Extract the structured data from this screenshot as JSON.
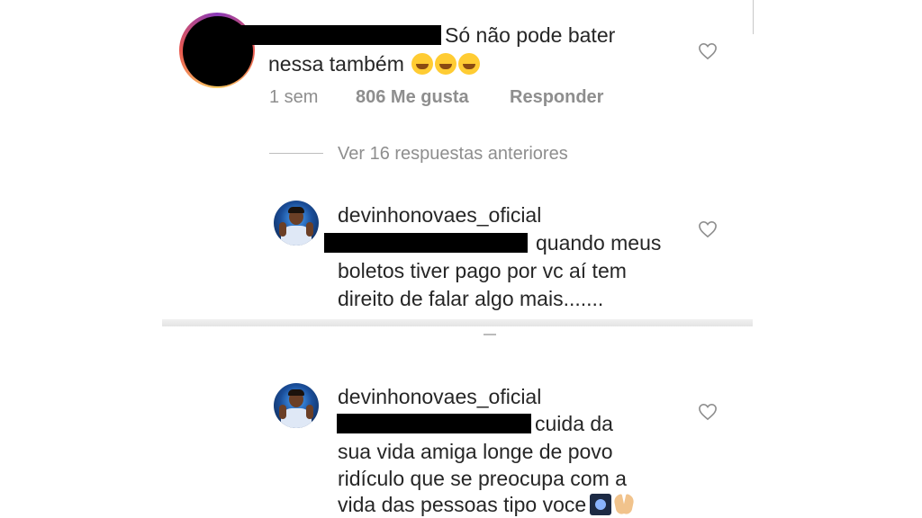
{
  "comments": [
    {
      "text_line1": "Só não pode bater",
      "text_line2": "nessa também",
      "emoji": "rolling-on-floor-laughing x3",
      "time": "1 sem",
      "likes": "806 Me gusta",
      "reply_label": "Responder"
    }
  ],
  "view_replies_label": "Ver 16 respuestas anteriores",
  "replies": [
    {
      "username": "devinhonovaes_oficial",
      "line1": "quando meus",
      "line2": "boletos tiver pago por vc aí tem",
      "line3": "direito de falar algo mais......."
    },
    {
      "username": "devinhonovaes_oficial",
      "line1": "cuida da",
      "line2": "sua vida amiga longe de povo",
      "line3": "ridículo que se preocupa com a",
      "line4": "vida das pessoas tipo voce",
      "emoji": "night-sky, folded-hands"
    }
  ],
  "icons": {
    "heart": "heart-outline-icon",
    "heart_color": "#8e8e8e",
    "redaction_color": "#000000"
  }
}
